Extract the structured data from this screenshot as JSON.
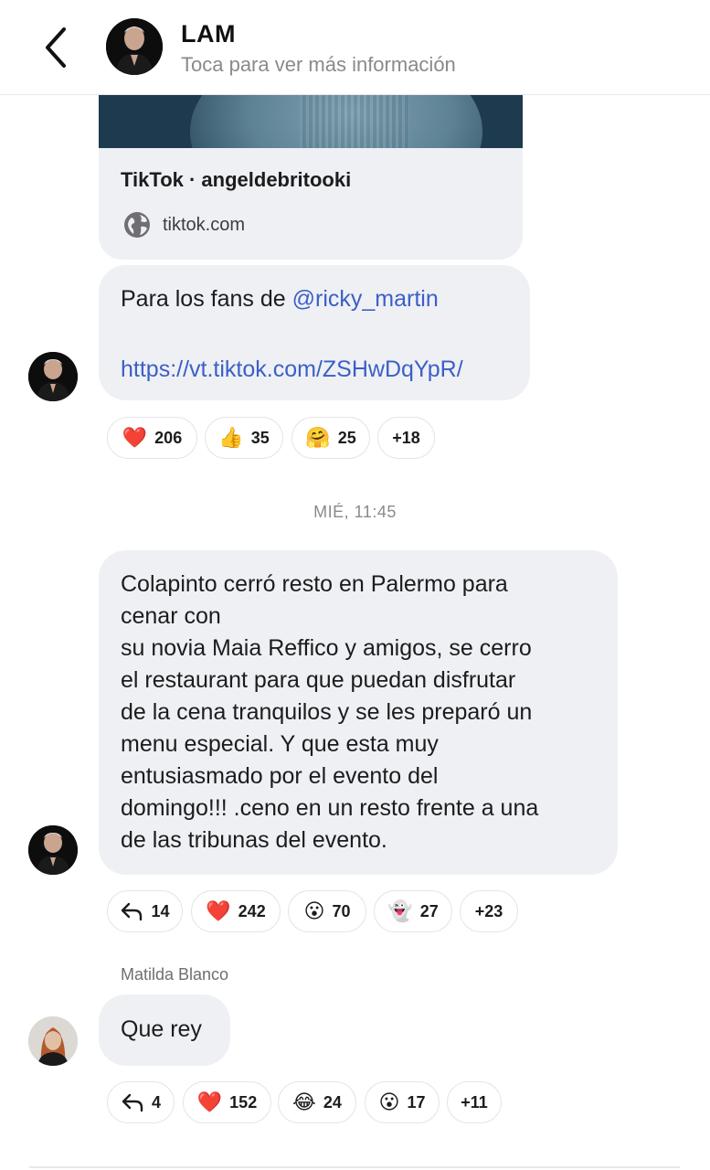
{
  "header": {
    "name": "LAM",
    "subtitle": "Toca para ver más información"
  },
  "link_preview": {
    "title": "TikTok · angeldebritooki",
    "domain": "tiktok.com"
  },
  "messages": [
    {
      "text_prefix": "Para los fans de ",
      "mention": "@ricky_martin",
      "url": "https://vt.tiktok.com/ZSHwDqYpR/",
      "reactions": [
        {
          "icon": "heart-icon",
          "emoji": "❤️",
          "count": "206"
        },
        {
          "icon": "thumbs-up-icon",
          "emoji": "👍",
          "count": "35"
        },
        {
          "icon": "hug-face-icon",
          "emoji": "🤗",
          "count": "25"
        },
        {
          "icon": "",
          "emoji": "",
          "count": "+18"
        }
      ]
    },
    {
      "lines": [
        "Colapinto cerró resto en Palermo para",
        "cenar con",
        "su novia Maia Reffico y amigos, se cerro",
        "el restaurant para que puedan disfrutar",
        "de la cena tranquilos y se les preparó un",
        "menu especial. Y que esta muy",
        "entusiasmado por el evento del",
        "domingo!!! .ceno en un resto frente a una",
        "de las tribunas del evento."
      ],
      "reactions": [
        {
          "icon": "reply-icon",
          "emoji": "",
          "count": "14"
        },
        {
          "icon": "heart-icon",
          "emoji": "❤️",
          "count": "242"
        },
        {
          "icon": "surprised-face-icon",
          "emoji": "😮",
          "count": "70"
        },
        {
          "icon": "ghost-icon",
          "emoji": "👻",
          "count": "27"
        },
        {
          "icon": "",
          "emoji": "",
          "count": "+23"
        }
      ]
    },
    {
      "sender": "Matilda Blanco",
      "text": "Que rey",
      "reactions": [
        {
          "icon": "reply-icon",
          "emoji": "",
          "count": "4"
        },
        {
          "icon": "heart-icon",
          "emoji": "❤️",
          "count": "152"
        },
        {
          "icon": "laughing-face-icon",
          "emoji": "😂",
          "count": "24"
        },
        {
          "icon": "surprised-face-icon",
          "emoji": "😮",
          "count": "17"
        },
        {
          "icon": "",
          "emoji": "",
          "count": "+11"
        }
      ]
    }
  ],
  "timestamp": "MIÉ, 11:45",
  "colors": {
    "bubble": "#eff0f4",
    "link": "#3b5fc6",
    "muted": "#8a8a8e"
  }
}
